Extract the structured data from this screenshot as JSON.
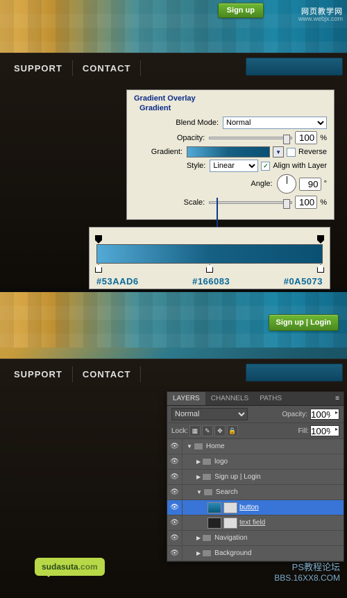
{
  "top": {
    "signup": "Sign up",
    "watermark": "网页教学网",
    "watermark_sub": "www.webjx.com",
    "nav": {
      "support": "SUPPORT",
      "contact": "CONTACT"
    }
  },
  "dialog": {
    "title": "Gradient Overlay",
    "subtitle": "Gradient",
    "blendmode_label": "Blend Mode:",
    "blendmode_value": "Normal",
    "opacity_label": "Opacity:",
    "opacity_value": "100",
    "gradient_label": "Gradient:",
    "reverse_label": "Reverse",
    "style_label": "Style:",
    "style_value": "Linear",
    "align_label": "Align with Layer",
    "angle_label": "Angle:",
    "angle_value": "90",
    "scale_label": "Scale:",
    "scale_value": "100",
    "pct": "%",
    "deg": "°"
  },
  "gradient": {
    "hex1": "#53AAD6",
    "hex2": "#166083",
    "hex3": "#0A5073"
  },
  "bot": {
    "signup_login": "Sign up   |   Login",
    "nav": {
      "support": "SUPPORT",
      "contact": "CONTACT"
    }
  },
  "layers": {
    "tabs": {
      "layers": "LAYERS",
      "channels": "CHANNELS",
      "paths": "PATHS"
    },
    "blendmode": "Normal",
    "opacity_label": "Opacity:",
    "opacity_value": "100%",
    "lock_label": "Lock:",
    "fill_label": "Fill:",
    "fill_value": "100%",
    "items": {
      "home": "Home",
      "logo": "logo",
      "signup": "Sign up   |   Login",
      "search": "Search",
      "button": "button",
      "textfield": "text field",
      "navigation": "Navigation",
      "background": "Background"
    }
  },
  "bubble": {
    "name": "sudasuta",
    "dot": ".com"
  },
  "wm_bot": {
    "l1": "PS教程论坛",
    "l2": "BBS.16XX8.COM"
  }
}
